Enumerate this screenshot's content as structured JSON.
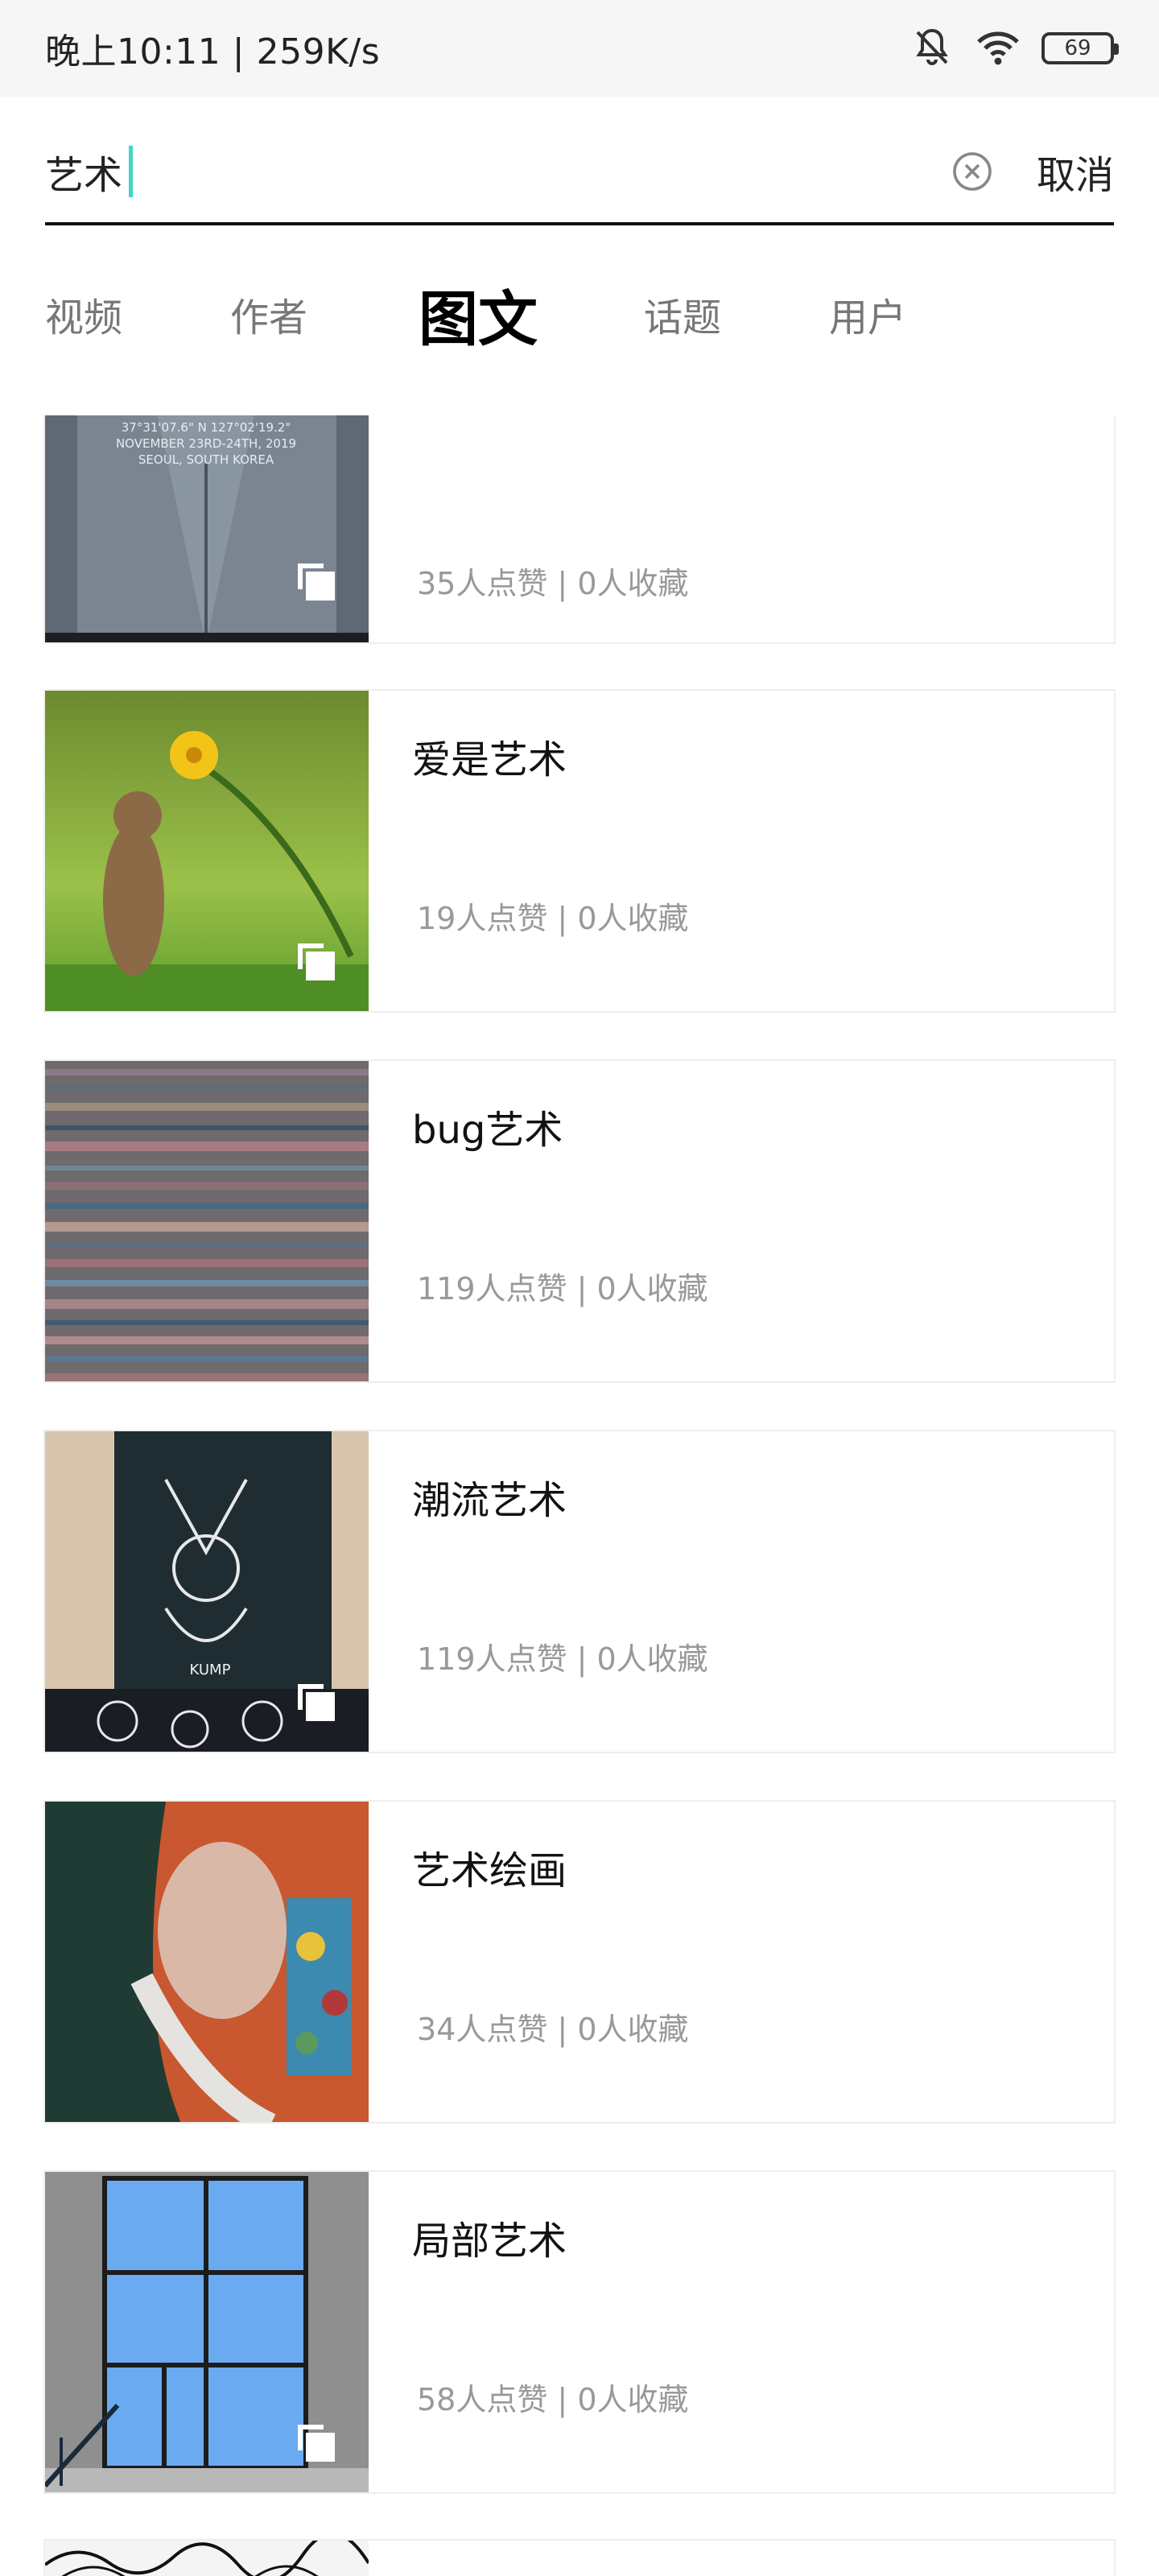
{
  "status_bar": {
    "time_speed": "晚上10:11 | 259K/s",
    "battery": "69",
    "icons": [
      "bell-muted-icon",
      "wifi-icon",
      "battery-icon"
    ]
  },
  "search": {
    "value": "艺术",
    "cancel_label": "取消",
    "clear_icon": "clear-circle-icon",
    "caret_color": "#3fd7c1"
  },
  "tabs": [
    {
      "label": "视频",
      "active": false
    },
    {
      "label": "作者",
      "active": false
    },
    {
      "label": "图文",
      "active": true
    },
    {
      "label": "话题",
      "active": false
    },
    {
      "label": "用户",
      "active": false
    }
  ],
  "results": [
    {
      "title": "",
      "meta": "35人点赞 | 0人收藏",
      "image": "gray-jacket-photo",
      "multi": true
    },
    {
      "title": "爱是艺术",
      "meta": "19人点赞 | 0人收藏",
      "image": "squirrel-flower-photo",
      "multi": true
    },
    {
      "title": "bug艺术",
      "meta": "119人点赞 | 0人收藏",
      "image": "glitch-art",
      "multi": false
    },
    {
      "title": "潮流艺术",
      "meta": "119人点赞 | 0人收藏",
      "image": "street-art-kump",
      "multi": true
    },
    {
      "title": "艺术绘画",
      "meta": "34人点赞 | 0人收藏",
      "image": "klimt-painting",
      "multi": false
    },
    {
      "title": "局部艺术",
      "meta": "58人点赞 | 0人收藏",
      "image": "window-photo",
      "multi": true
    }
  ],
  "partial_image": "line-drawing",
  "photo_texts": {
    "jacket_line1": "37°31'07.6\" N 127°02'19.2\"",
    "jacket_line2": "NOVEMBER 23RD-24TH, 2019",
    "jacket_line3": "SEOUL, SOUTH KOREA",
    "kump": "KUMP"
  }
}
